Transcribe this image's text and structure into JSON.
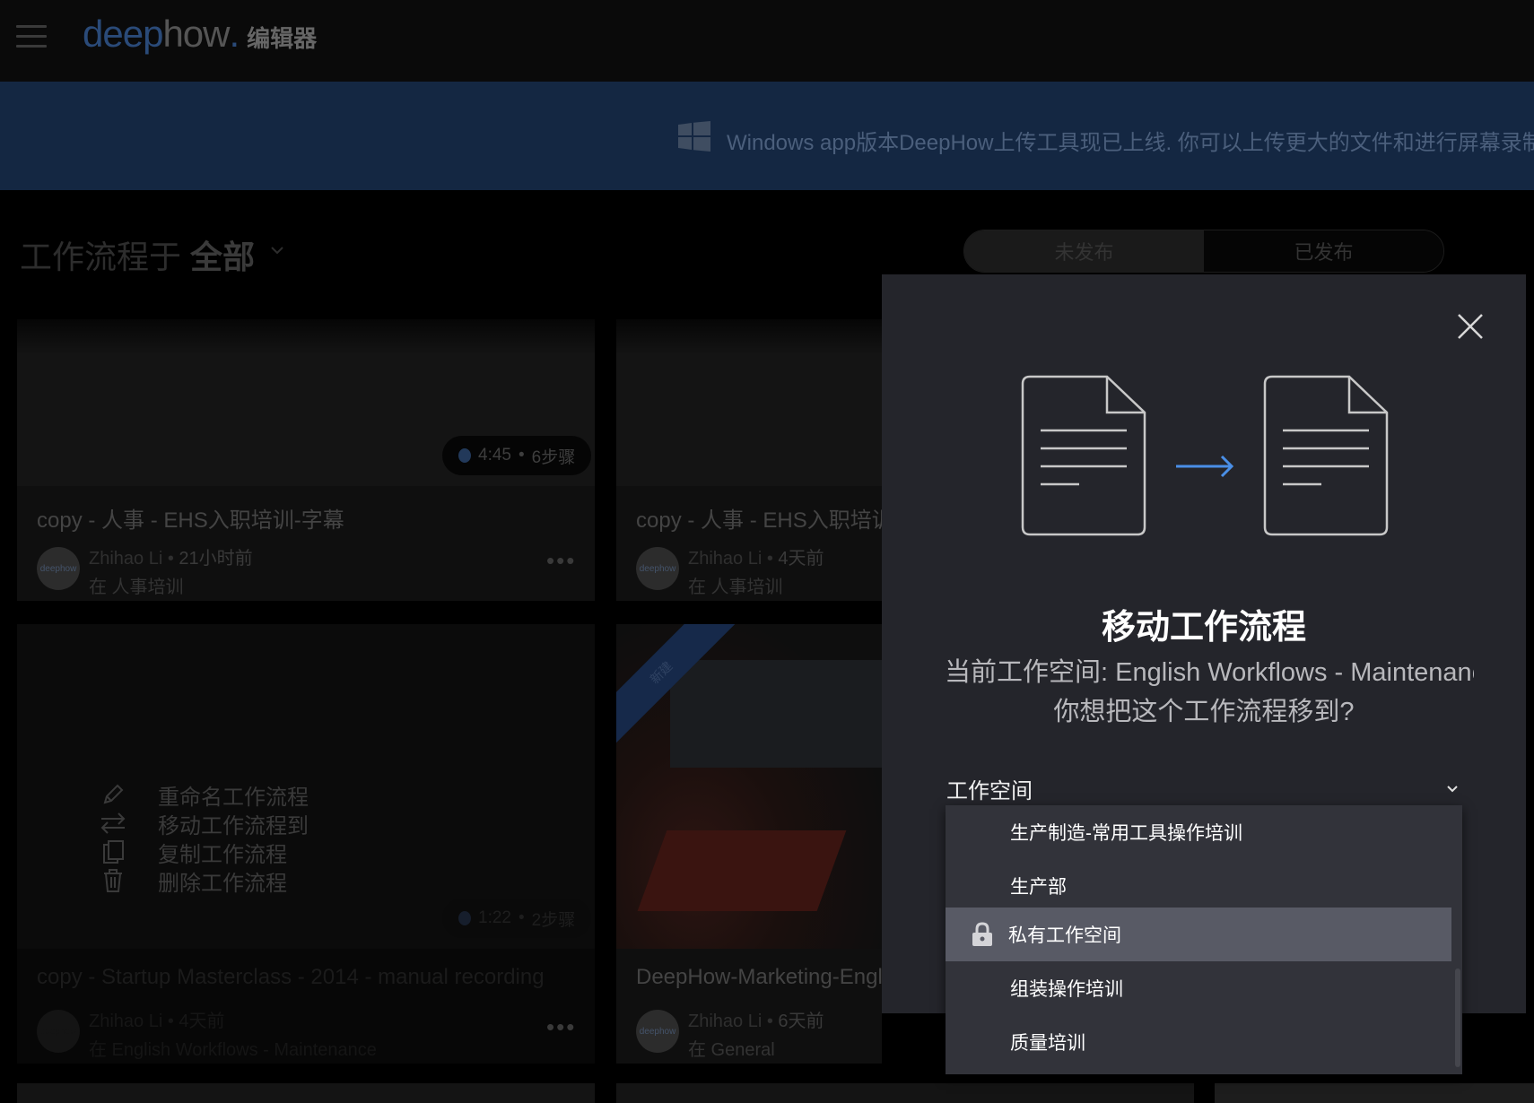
{
  "header": {
    "menu_icon": "hamburger-icon",
    "logo_deep": "deep",
    "logo_how": "how",
    "logo_dot": ".",
    "logo_editor": "编辑器"
  },
  "banner": {
    "icon": "windows-icon",
    "text": "Windows app版本DeepHow上传工具现已上线. 你可以上传更大的文件和进行屏幕录制"
  },
  "page": {
    "title_prefix": "工作流程于",
    "title_scope": "全部",
    "toggle_unpublished": "未发布",
    "toggle_published": "已发布"
  },
  "cards": [
    {
      "title": "copy - 人事 - EHS入职培训-字幕",
      "duration": "4:45",
      "steps": "6步骤",
      "author": "Zhihao Li",
      "time": "21小时前",
      "location": "在 人事培训",
      "avatar_text": "deephow"
    },
    {
      "title": "copy - 人事 - EHS入职培训",
      "author": "Zhihao Li",
      "time": "4天前",
      "location": "在 人事培训",
      "avatar_text": "deephow"
    },
    {
      "title": "copy - Startup Masterclass - 2014 - manual recording",
      "duration": "1:22",
      "steps": "2步骤",
      "author": "Zhihao Li",
      "time": "4天前",
      "location": "在 English Workflows - Maintenance",
      "avatar_text": "deephow"
    },
    {
      "title": "DeepHow-Marketing-English",
      "ribbon": "新建",
      "author": "Zhihao Li",
      "time": "6天前",
      "location": "在 General",
      "avatar_text": "deephow"
    }
  ],
  "context_menu": [
    {
      "label": "重命名工作流程",
      "icon": "pencil-icon"
    },
    {
      "label": "移动工作流程到",
      "icon": "swap-arrows-icon"
    },
    {
      "label": "复制工作流程",
      "icon": "copy-icon"
    },
    {
      "label": "删除工作流程",
      "icon": "trash-icon"
    }
  ],
  "modal": {
    "title": "移动工作流程",
    "current_workspace": "当前工作空间: English Workflows - Maintenance",
    "question": "你想把这个工作流程移到?",
    "select_label": "工作空间",
    "close_icon": "close-icon",
    "illustration_icon": "move-document-icon"
  },
  "dropdown": {
    "items": [
      {
        "label": "生产制造-常用工具操作培训",
        "selected": false
      },
      {
        "label": "生产部",
        "selected": false
      },
      {
        "label": "私有工作空间",
        "selected": true,
        "icon": "lock-icon"
      },
      {
        "label": "组装操作培训",
        "selected": false
      },
      {
        "label": "质量培训",
        "selected": false
      }
    ]
  },
  "colors": {
    "accent_blue": "#4a8fe7",
    "modal_bg": "#24252b",
    "dropdown_bg": "#32333a",
    "dropdown_selected": "#585a65"
  }
}
